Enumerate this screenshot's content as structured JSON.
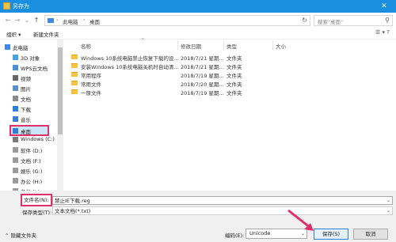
{
  "window": {
    "title": "另存为",
    "close_glyph": "✕"
  },
  "address": {
    "back": "←",
    "forward": "→",
    "up_dropdown": "⌄",
    "up": "↑",
    "crumbs": [
      "此电脑",
      "桌面"
    ],
    "sep": "›",
    "refresh": "↻"
  },
  "search": {
    "placeholder": "搜索\"桌面\"",
    "icon": "⚲"
  },
  "toolbar": {
    "organize": "组织 ▾",
    "new_folder": "新建文件夹",
    "view": "☰ ▾   ?"
  },
  "sidebar": {
    "items": [
      {
        "label": "此电脑",
        "icon": "computer-icon",
        "color": "#3d8be0"
      },
      {
        "label": "3D 对象",
        "icon": "cube-icon",
        "color": "#4aa3df"
      },
      {
        "label": "WPS云文档",
        "icon": "cloud-icon",
        "color": "#4a90d9"
      },
      {
        "label": "视频",
        "icon": "video-icon",
        "color": "#666666"
      },
      {
        "label": "图片",
        "icon": "picture-icon",
        "color": "#5b8fc9"
      },
      {
        "label": "文档",
        "icon": "document-icon",
        "color": "#8a8a8a"
      },
      {
        "label": "下载",
        "icon": "download-icon",
        "color": "#2f7ed8"
      },
      {
        "label": "音乐",
        "icon": "music-icon",
        "color": "#3b7dd8"
      },
      {
        "label": "桌面",
        "icon": "desktop-icon",
        "color": "#2f7ed8",
        "selected": true
      },
      {
        "label": "Windows (C:)",
        "icon": "drive-icon",
        "color": "#7a7a7a"
      },
      {
        "label": "软件 (D:)",
        "icon": "drive-icon",
        "color": "#9a9a9a"
      },
      {
        "label": "文档 (F:)",
        "icon": "drive-icon",
        "color": "#9a9a9a"
      },
      {
        "label": "娱乐 (G:)",
        "icon": "drive-icon",
        "color": "#9a9a9a"
      },
      {
        "label": "办公 (H:)",
        "icon": "drive-icon",
        "color": "#9a9a9a"
      },
      {
        "label": "备份 (I:)",
        "icon": "drive-icon",
        "color": "#9a9a9a"
      }
    ]
  },
  "list": {
    "columns": [
      "名称",
      "修改日期",
      "类型",
      "大小"
    ],
    "sort_glyph": "^",
    "rows": [
      {
        "name": "Windows 10系统电脑禁止恢复下载的设...",
        "date": "2018/7/21 星期...",
        "type": "文件夹"
      },
      {
        "name": "安装Windows 10系统电脑关机时自动清...",
        "date": "2018/7/21 星期...",
        "type": "文件夹"
      },
      {
        "name": "常用程序",
        "date": "2018/7/19 星期...",
        "type": "文件夹"
      },
      {
        "name": "常用文件",
        "date": "2018/7/20 星期...",
        "type": "文件夹"
      },
      {
        "name": "一尿文件",
        "date": "2018/7/19 星期...",
        "type": "文件夹"
      }
    ]
  },
  "bottom": {
    "filename_label": "文件名(N):",
    "filename_value": "禁止IE下载.reg",
    "filetype_label": "保存类型(T):",
    "filetype_value": "文本文档(*.txt)",
    "hide_folders": "⌃ 隐藏文件夹",
    "encoding_label": "编码(E):",
    "encoding_value": "Unicode",
    "save": "保存(S)",
    "cancel": "取消"
  },
  "colors": {
    "titlebar": "#1a8fe0",
    "highlight": "#e0306a",
    "selection": "#cce4f7"
  }
}
